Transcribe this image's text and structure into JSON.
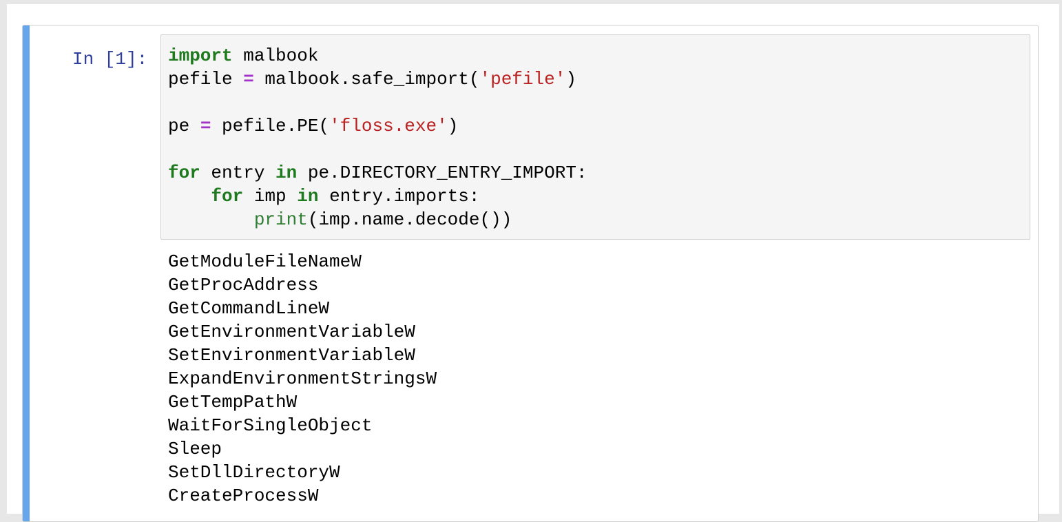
{
  "cell": {
    "prompt": "In [1]:",
    "code": {
      "l1_kw": "import",
      "l1_rest": " malbook",
      "l2_a": "pefile ",
      "l2_op": "=",
      "l2_b": " malbook.safe_import(",
      "l2_str": "'pefile'",
      "l2_c": ")",
      "l4_a": "pe ",
      "l4_op": "=",
      "l4_b": " pefile.PE(",
      "l4_str": "'floss.exe'",
      "l4_c": ")",
      "l6_kw1": "for",
      "l6_a": " entry ",
      "l6_kw2": "in",
      "l6_b": " pe.DIRECTORY_ENTRY_IMPORT:",
      "l7_indent": "    ",
      "l7_kw1": "for",
      "l7_a": " imp ",
      "l7_kw2": "in",
      "l7_b": " entry.imports:",
      "l8_indent": "        ",
      "l8_builtin": "print",
      "l8_b": "(imp.name.decode())"
    },
    "output": [
      "GetModuleFileNameW",
      "GetProcAddress",
      "GetCommandLineW",
      "GetEnvironmentVariableW",
      "SetEnvironmentVariableW",
      "ExpandEnvironmentStringsW",
      "GetTempPathW",
      "WaitForSingleObject",
      "Sleep",
      "SetDllDirectoryW",
      "CreateProcessW"
    ]
  },
  "colors": {
    "selection_bar": "#66a6ec",
    "prompt": "#303f9f",
    "keyword": "#1f7a1f",
    "operator": "#a333c8",
    "string": "#ba2121",
    "code_background": "#f5f5f5"
  }
}
